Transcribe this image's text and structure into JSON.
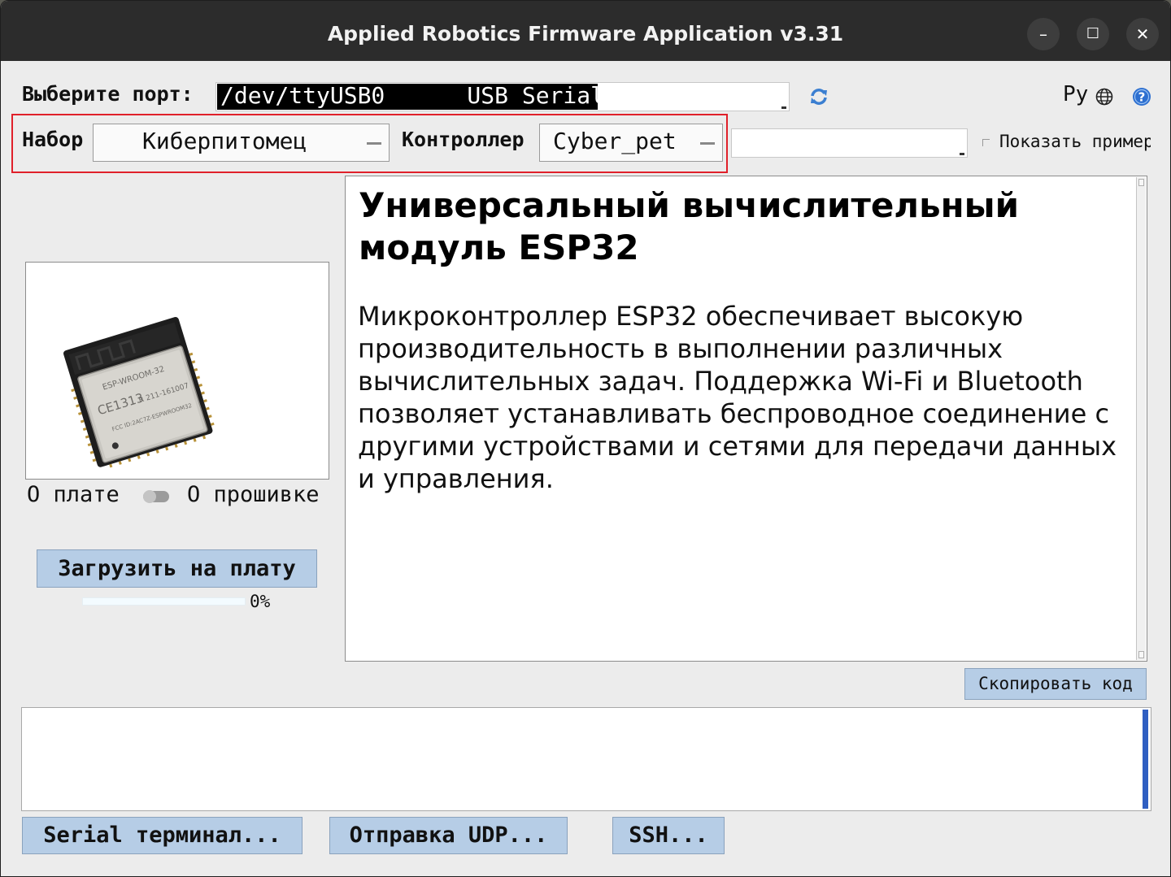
{
  "window": {
    "title": "Applied Robotics Firmware Application v3.31",
    "controls": {
      "minimize": "–",
      "maximize": "☐",
      "close": "✕"
    }
  },
  "port": {
    "label": "Выберите порт:",
    "value": "/dev/ttyUSB0      USB Serial",
    "refresh_icon": "refresh-icon",
    "language": "Ру",
    "globe_icon": "globe-icon",
    "help_icon": "help-icon"
  },
  "kit": {
    "label": "Набор",
    "value": "Киберпитомец"
  },
  "controller": {
    "label": "Контроллер",
    "value": "Cyber_pet",
    "extra_value": ""
  },
  "show_examples": {
    "label": "Показать пример",
    "checked": false
  },
  "board": {
    "image_label": "ESP-WROOM-32",
    "image_cert": "CE1313",
    "about_board": "О плате",
    "about_firmware": "О прошивке",
    "upload_button": "Загрузить на плату",
    "progress_text": "0%",
    "progress_fraction": 0.0
  },
  "description": {
    "title": "Универсальный вычислительный модуль ESP32",
    "text": "Микроконтроллер ESP32 обеспечивает высокую производительность в выполнении различных вычислительных задач. Поддержка Wi-Fi и Bluetooth позволяет устанавливать беспроводное соединение с другими устройствами и сетями для передачи данных и управления."
  },
  "copy_code_button": "Скопировать код",
  "console": {
    "text": ""
  },
  "bottom_buttons": {
    "serial": "Serial терминал...",
    "udp": "Отправка UDP...",
    "ssh": "SSH..."
  },
  "colors": {
    "titlebar": "#2c2c2c",
    "button": "#b6cde6",
    "highlight": "#e0202a",
    "scrollbar_accent": "#2f5fc2"
  }
}
